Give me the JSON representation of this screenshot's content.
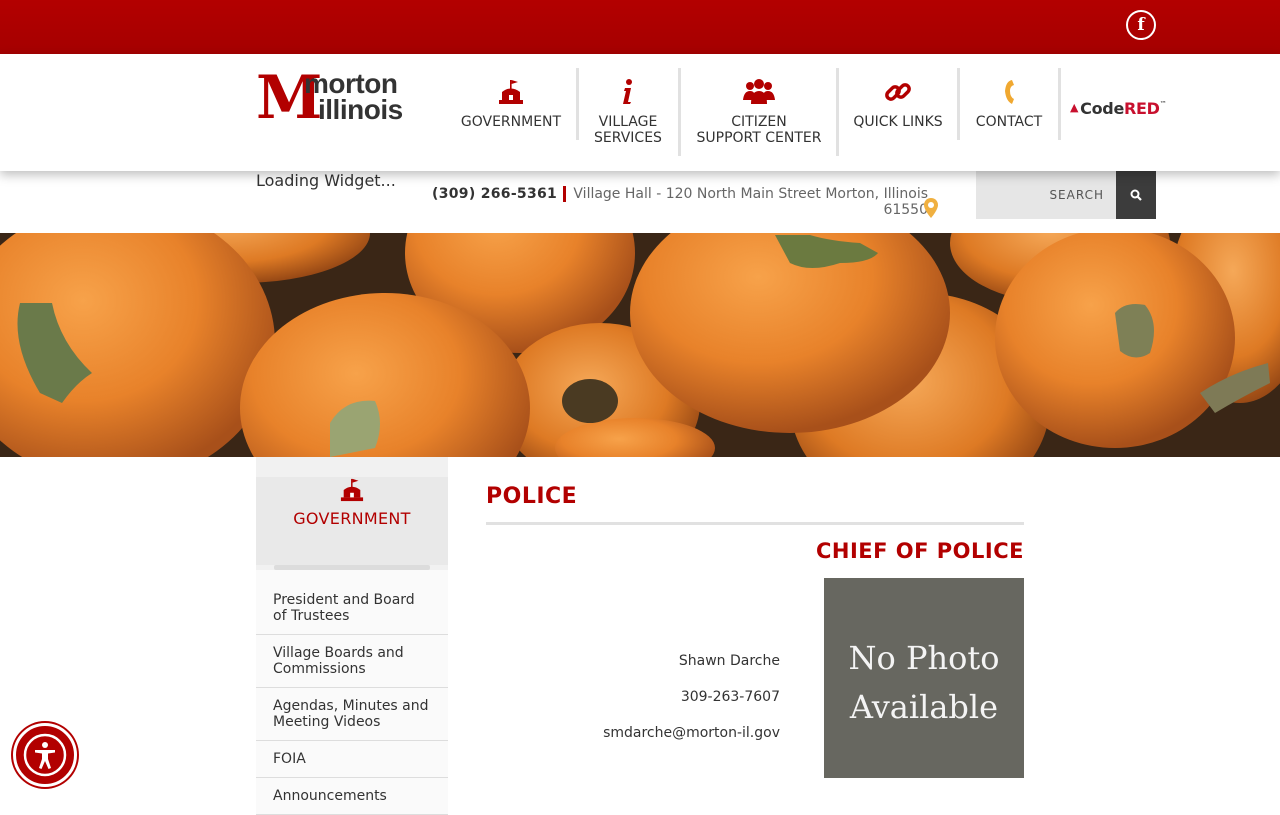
{
  "social": {
    "facebook_icon": "facebook-icon"
  },
  "logo": {
    "mark": "M",
    "line1": "morton",
    "line2": "illinois"
  },
  "nav": [
    {
      "label": "GOVERNMENT",
      "icon": "town-hall-icon"
    },
    {
      "label": "VILLAGE\nSERVICES",
      "icon": "info-icon"
    },
    {
      "label": "CITIZEN\nSUPPORT CENTER",
      "icon": "people-icon"
    },
    {
      "label": "QUICK LINKS",
      "icon": "link-icon"
    },
    {
      "label": "CONTACT",
      "icon": "phone-icon"
    }
  ],
  "codered": {
    "part1": "Code",
    "part2": "RED",
    "tm": "™"
  },
  "infobar": {
    "loading": "Loading Widget...",
    "phone": "(309) 266-5361",
    "address": "Village Hall - 120 North Main Street Morton, Illinois 61550",
    "search_placeholder": "SEARCH"
  },
  "sidebar": {
    "title": "GOVERNMENT",
    "items": [
      {
        "label": "President and Board of Trustees"
      },
      {
        "label": "Village Boards and Commissions"
      },
      {
        "label": "Agendas, Minutes and Meeting Videos"
      },
      {
        "label": "FOIA"
      },
      {
        "label": "Announcements"
      }
    ]
  },
  "content": {
    "title": "POLICE",
    "subtitle": "CHIEF OF POLICE",
    "name": "Shawn Darche",
    "phone": "309-263-7607",
    "email": "smdarche@morton-il.gov",
    "photo_placeholder_line1": "No Photo",
    "photo_placeholder_line2": "Available"
  },
  "colors": {
    "brand_red": "#b20000",
    "accent_gold": "#f0a830",
    "dark": "#3c3c3c"
  }
}
